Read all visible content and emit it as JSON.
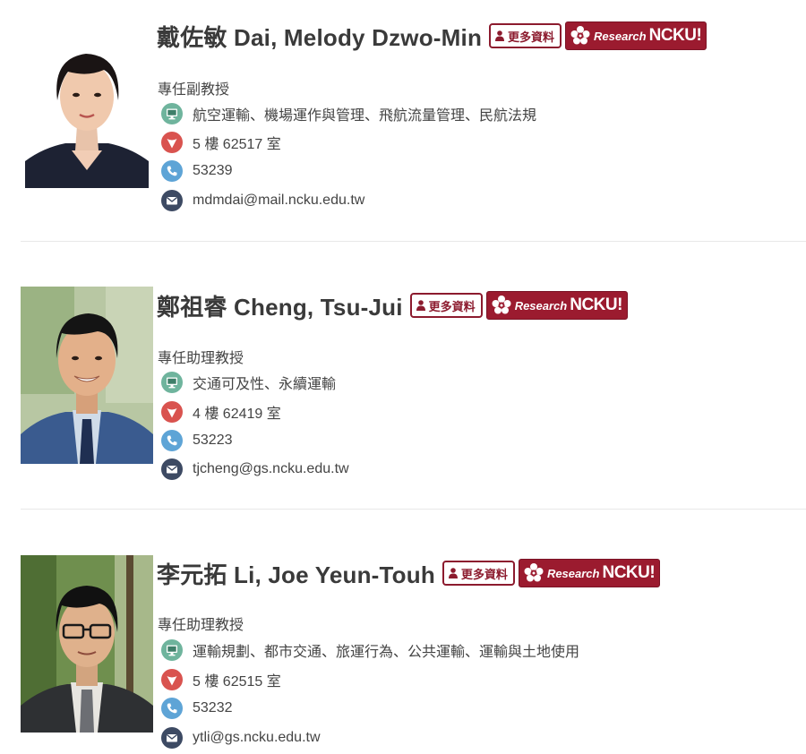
{
  "faculty": [
    {
      "name": "戴佐敏 Dai, Melody Dzwo-Min",
      "more_label": "更多資料",
      "research_label": "Research",
      "research_brand": "NCKU!",
      "title": "專任副教授",
      "research_areas": "航空運輸、機場運作與管理、飛航流量管理、民航法規",
      "office": "5 樓 62517 室",
      "phone": "53239",
      "email": "mdmdai@mail.ncku.edu.tw"
    },
    {
      "name": "鄭祖睿 Cheng, Tsu-Jui",
      "more_label": "更多資料",
      "research_label": "Research",
      "research_brand": "NCKU!",
      "title": "專任助理教授",
      "research_areas": "交通可及性、永續運輸",
      "office": "4 樓 62419 室",
      "phone": "53223",
      "email": "tjcheng@gs.ncku.edu.tw"
    },
    {
      "name": "李元拓 Li, Joe Yeun-Touh",
      "more_label": "更多資料",
      "research_label": "Research",
      "research_brand": "NCKU!",
      "title": "專任助理教授",
      "research_areas": "運輸規劃、都市交通、旅運行為、公共運輸、運輸與土地使用",
      "office": "5 樓 62515 室",
      "phone": "53232",
      "email": "ytli@gs.ncku.edu.tw"
    }
  ],
  "icons": {
    "research_areas": "monitor-icon",
    "office": "location-icon",
    "phone": "phone-icon",
    "email": "mail-icon"
  },
  "colors": {
    "brand": "#9b1b2f",
    "monitor_bg": "#6fb49d",
    "location_bg": "#d9534f",
    "phone_bg": "#5ea4d6",
    "mail_bg": "#3d4a63",
    "divider": "#e8e8e8"
  }
}
